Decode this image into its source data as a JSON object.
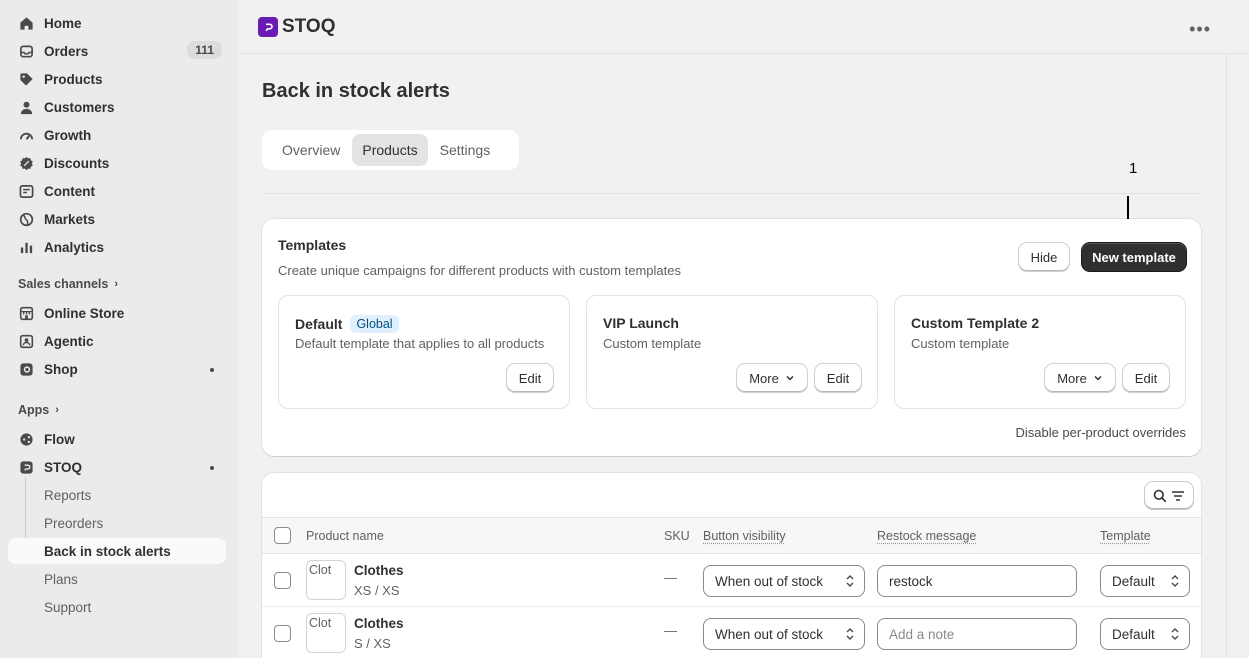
{
  "sidebar": {
    "items": [
      {
        "label": "Home",
        "icon": "home-icon"
      },
      {
        "label": "Orders",
        "icon": "orders-icon",
        "badge": "111"
      },
      {
        "label": "Products",
        "icon": "tag-icon"
      },
      {
        "label": "Customers",
        "icon": "person-icon"
      },
      {
        "label": "Growth",
        "icon": "gauge-icon"
      },
      {
        "label": "Discounts",
        "icon": "discount-icon"
      },
      {
        "label": "Content",
        "icon": "content-icon"
      },
      {
        "label": "Markets",
        "icon": "globe-icon"
      },
      {
        "label": "Analytics",
        "icon": "bar-chart-icon"
      }
    ],
    "sales_channels_label": "Sales channels",
    "channels": [
      {
        "label": "Online Store",
        "icon": "store-icon"
      },
      {
        "label": "Agentic",
        "icon": "agent-icon"
      },
      {
        "label": "Shop",
        "icon": "shop-icon"
      }
    ],
    "apps_label": "Apps",
    "apps": [
      {
        "label": "Flow",
        "icon": "flow-icon"
      },
      {
        "label": "STOQ",
        "icon": "stoq-icon"
      }
    ],
    "stoq_sub": [
      "Reports",
      "Preorders",
      "Back in stock alerts",
      "Plans",
      "Support"
    ]
  },
  "topbar": {
    "app_name": "STOQ",
    "more_glyph": "•••"
  },
  "page": {
    "title": "Back in stock alerts"
  },
  "tabs": [
    "Overview",
    "Products",
    "Settings"
  ],
  "annotation": {
    "number": "1"
  },
  "templates": {
    "title": "Templates",
    "subtitle": "Create unique campaigns for different products with custom templates",
    "hide_label": "Hide",
    "new_label": "New template",
    "cards": [
      {
        "name": "Default",
        "badge": "Global",
        "description": "Default template that applies to all products",
        "edit": "Edit"
      },
      {
        "name": "VIP Launch",
        "description": "Custom template",
        "more": "More",
        "edit": "Edit"
      },
      {
        "name": "Custom Template 2",
        "description": "Custom template",
        "more": "More",
        "edit": "Edit"
      }
    ],
    "disable_link": "Disable per-product overrides"
  },
  "table": {
    "headers": {
      "product": "Product name",
      "sku": "SKU",
      "visibility": "Button visibility",
      "message": "Restock message",
      "template": "Template"
    },
    "rows": [
      {
        "thumb_alt": "Clot",
        "name": "Clothes",
        "variant": "XS / XS",
        "sku": "—",
        "visibility": "When out of stock",
        "message": "restock",
        "message_placeholder": "Add a note",
        "template": "Default"
      },
      {
        "thumb_alt": "Clot",
        "name": "Clothes",
        "variant": "S / XS",
        "sku": "—",
        "visibility": "When out of stock",
        "message": "",
        "message_placeholder": "Add a note",
        "template": "Default"
      }
    ]
  },
  "colors": {
    "brand": "#6a1bb3",
    "primary_button": "#303030",
    "global_badge_bg": "#e0f0ff"
  }
}
